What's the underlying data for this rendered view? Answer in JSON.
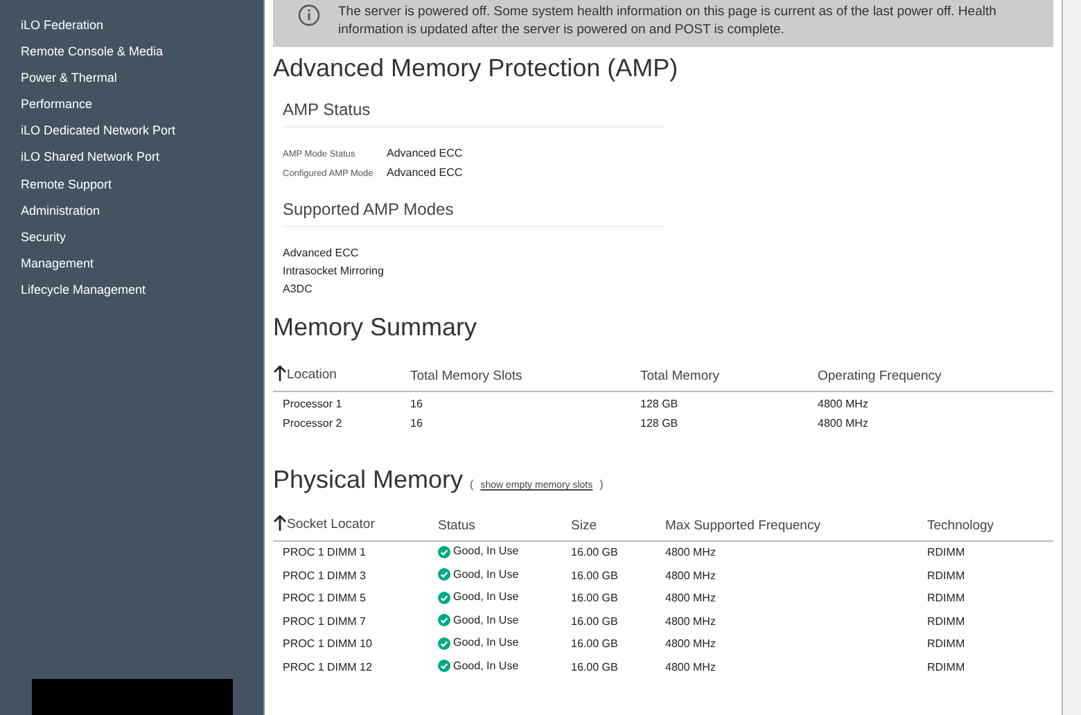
{
  "sidebar": {
    "items": [
      {
        "label": "iLO Federation"
      },
      {
        "label": "Remote Console & Media"
      },
      {
        "label": "Power & Thermal"
      },
      {
        "label": "Performance"
      },
      {
        "label": "iLO Dedicated Network Port"
      },
      {
        "label": "iLO Shared Network Port"
      },
      {
        "label": "Remote Support"
      },
      {
        "label": "Administration"
      },
      {
        "label": "Security"
      },
      {
        "label": "Management"
      },
      {
        "label": "Lifecycle Management"
      }
    ]
  },
  "notice": {
    "text": "The server is powered off. Some system health information on this page is current as of the last power off. Health information is updated after the server is powered on and POST is complete."
  },
  "amp": {
    "title": "Advanced Memory Protection (AMP)",
    "status_title": "AMP Status",
    "status_rows": [
      {
        "label": "AMP Mode Status",
        "value": "Advanced ECC"
      },
      {
        "label": "Configured AMP Mode",
        "value": "Advanced ECC"
      }
    ],
    "modes_title": "Supported AMP Modes",
    "modes": [
      "Advanced ECC",
      "Intrasocket Mirroring",
      "A3DC"
    ]
  },
  "memory_summary": {
    "title": "Memory Summary",
    "columns": [
      "Location",
      "Total Memory Slots",
      "Total Memory",
      "Operating Frequency"
    ],
    "rows": [
      [
        "Processor 1",
        "16",
        "128 GB",
        "4800 MHz"
      ],
      [
        "Processor 2",
        "16",
        "128 GB",
        "4800 MHz"
      ]
    ]
  },
  "physical_memory": {
    "title": "Physical Memory",
    "link_open": "(",
    "link": "show empty memory slots",
    "link_close": ")",
    "columns": [
      "Socket Locator",
      "Status",
      "Size",
      "Max Supported Frequency",
      "Technology"
    ],
    "rows": [
      {
        "socket": "PROC 1 DIMM 1",
        "ok": true,
        "status": "Good, In Use",
        "size": "16.00 GB",
        "frequency": "4800 MHz",
        "technology": "RDIMM"
      },
      {
        "socket": "PROC 1 DIMM 3",
        "ok": true,
        "status": "Good, In Use",
        "size": "16.00 GB",
        "frequency": "4800 MHz",
        "technology": "RDIMM"
      },
      {
        "socket": "PROC 1 DIMM 5",
        "ok": true,
        "status": "Good, In Use",
        "size": "16.00 GB",
        "frequency": "4800 MHz",
        "technology": "RDIMM"
      },
      {
        "socket": "PROC 1 DIMM 7",
        "ok": true,
        "status": "Good, In Use",
        "size": "16.00 GB",
        "frequency": "4800 MHz",
        "technology": "RDIMM"
      },
      {
        "socket": "PROC 1 DIMM 10",
        "ok": true,
        "status": "Good, In Use",
        "size": "16.00 GB",
        "frequency": "4800 MHz",
        "technology": "RDIMM"
      },
      {
        "socket": "PROC 1 DIMM 12",
        "ok": true,
        "status": "Good, In Use",
        "size": "16.00 GB",
        "frequency": "4800 MHz",
        "technology": "RDIMM"
      }
    ]
  }
}
